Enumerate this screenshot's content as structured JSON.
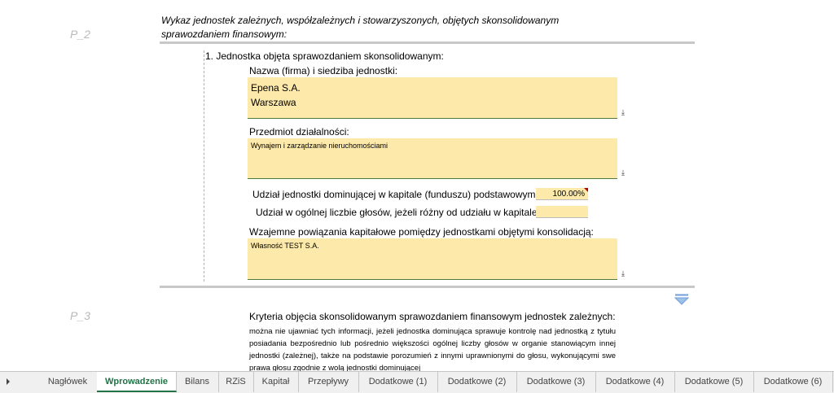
{
  "section_labels": {
    "p2": "P_2",
    "p3": "P_3"
  },
  "heading": "Wykaz jednostek zależnych, współzależnych i stowarzyszonych, objętych skonsolidowanym sprawozdaniem finansowym:",
  "item_title": "1. Jednostka objęta sprawozdaniem skonsolidowanym:",
  "name_label": "Nazwa (firma) i siedziba jednostki:",
  "name_value": "Epena S.A.\nWarszawa",
  "activity_label": "Przedmiot działalności:",
  "activity_value": "Wynajem i zarządzanie nieruchomościami",
  "share_capital_label": "Udział jednostki dominującej w kapitale (funduszu) podstawowym",
  "share_capital_value": "100.00%",
  "share_votes_label": "Udział w ogólnej liczbie głosów, jeżeli różny od udziału w kapitale",
  "share_votes_value": "",
  "relations_label": "Wzajemne powiązania kapitałowe pomiędzy jednostkami objętymi konsolidacją:",
  "relations_value": "Własność TEST S.A.",
  "expand_glyph": "⤓",
  "criteria_title": "Kryteria objęcia skonsolidowanym sprawozdaniem finansowym jednostek zależnych:",
  "criteria_text": "można nie ujawniać tych informacji, jeżeli jednostka dominująca sprawuje kontrolę nad jednostką z tytułu posiadania bezpośrednio lub pośrednio większości ogólnej liczby głosów w organie stanowiącym innej jednostki (zależnej), także na podstawie porozumień z innymi uprawnionymi do głosu, wykonującymi swe prawa głosu zgodnie z wolą jednostki dominującej",
  "tabs": [
    "Nagłówek",
    "Wprowadzenie",
    "Bilans",
    "RZiS",
    "Kapitał",
    "Przepływy",
    "Dodatkowe (1)",
    "Dodatkowe (2)",
    "Dodatkowe (3)",
    "Dodatkowe (4)",
    "Dodatkowe (5)",
    "Dodatkowe (6)"
  ],
  "active_tab": "Wprowadzenie",
  "colors": {
    "field_bg": "#fde9a9",
    "accent": "#217346",
    "section_label": "#b9b9b9",
    "marker": "#c00000",
    "collapse_icon": "#6f9fd8"
  }
}
